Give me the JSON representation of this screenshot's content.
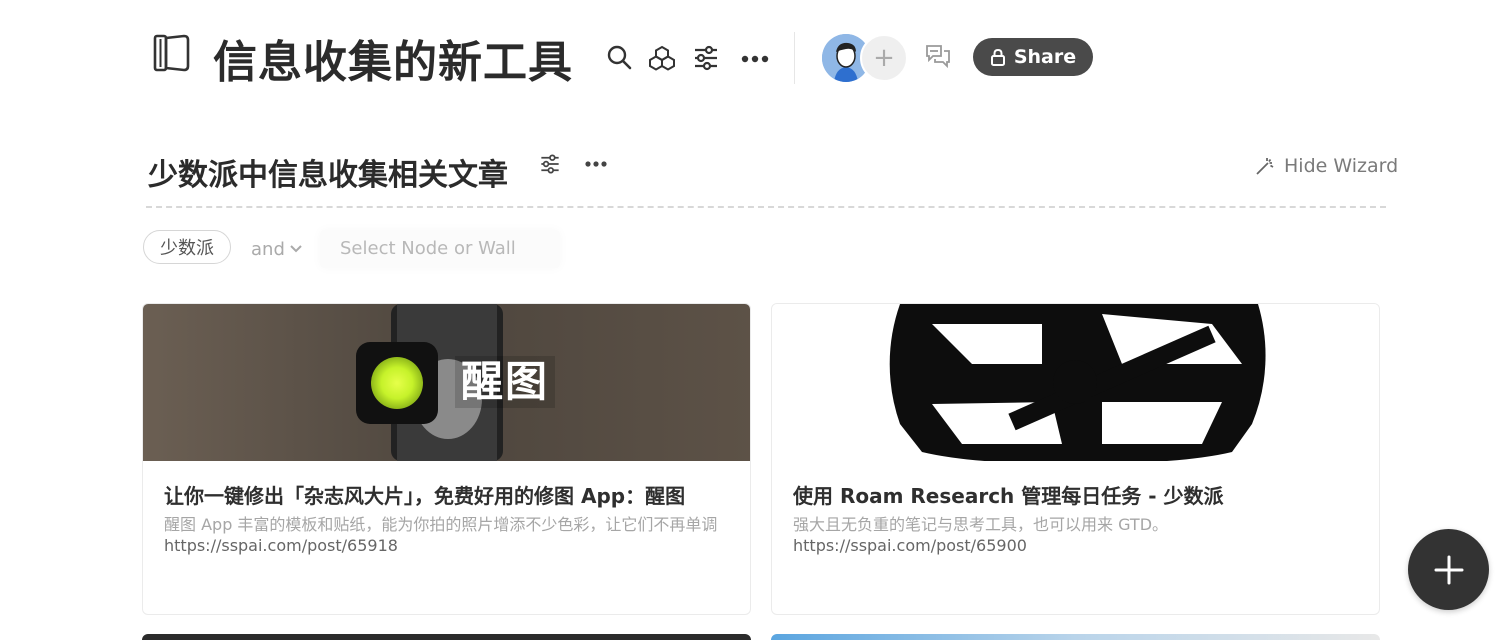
{
  "header": {
    "title": "信息收集的新工具",
    "share_label": "Share",
    "icons": [
      "wall-icon",
      "search-icon",
      "blocks-icon",
      "filter-icon",
      "more-icon",
      "add-icon",
      "comments-icon",
      "lock-icon"
    ]
  },
  "section": {
    "title": "少数派中信息收集相关文章",
    "hide_wizard_label": "Hide Wizard"
  },
  "filter": {
    "tag": "少数派",
    "operator": "and",
    "node_placeholder": "Select Node or Wall"
  },
  "cards": [
    {
      "title": "让你一键修出「杂志风大片」，免费好用的修图 App：醒图",
      "description": "醒图 App 丰富的模板和贴纸，能为你拍的照片增添不少色彩，让它们不再单调",
      "url": "https://sspai.com/post/65918",
      "image_text": "醒图"
    },
    {
      "title": "使用 Roam Research 管理每日任务 - 少数派",
      "description": "强大且无负重的笔记与思考工具，也可以用来 GTD。",
      "url": "https://sspai.com/post/65900"
    }
  ],
  "colors": {
    "share_button_bg": "#4a4a4a",
    "fab_bg": "#333333",
    "app_icon_green": "#c6f22a"
  }
}
